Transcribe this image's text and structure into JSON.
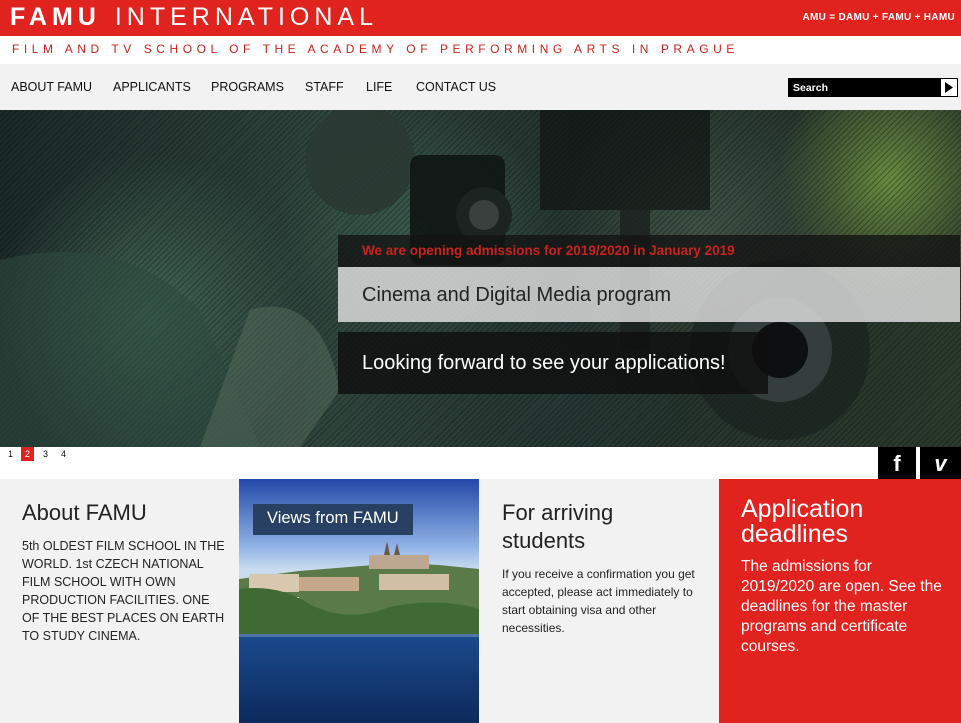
{
  "header": {
    "logo_bold": "FAMU",
    "logo_light": "INTERNATIONAL",
    "amu_links": "AMU = DAMU + FAMU + HAMU",
    "subtitle": "FILM AND TV SCHOOL OF THE ACADEMY OF PERFORMING ARTS IN PRAGUE",
    "brand_color": "#e1231f"
  },
  "nav": {
    "items": [
      "ABOUT FAMU",
      "APPLICANTS",
      "PROGRAMS",
      "STAFF",
      "LIFE",
      "CONTACT US"
    ]
  },
  "search": {
    "placeholder": "Search",
    "icon": "play-triangle-icon"
  },
  "hero": {
    "admission": "We are opening admissions for 2019/2020 in January 2019",
    "program": "Cinema and Digital Media program",
    "looking": "Looking forward to see your applications!"
  },
  "pager": {
    "pages": [
      "1",
      "2",
      "3",
      "4"
    ],
    "active": "2"
  },
  "social": {
    "facebook": "f",
    "vimeo": "v"
  },
  "boxes": {
    "about": {
      "title": "About FAMU",
      "text": "5th OLDEST FILM SCHOOL IN THE WORLD. 1st CZECH NATIONAL FILM SCHOOL WITH OWN PRODUCTION FACILITIES. ONE OF THE BEST PLACES ON EARTH TO STUDY CINEMA."
    },
    "views": {
      "label": "Views from FAMU"
    },
    "arriving": {
      "title": "For arriving students",
      "text": "If you receive a confirmation you get accepted, please act immediately to start obtaining visa and other necessities."
    },
    "deadlines": {
      "title": "Application deadlines",
      "text": "The admissions for 2019/2020 are open. See the deadlines for the master programs and certificate courses."
    }
  }
}
